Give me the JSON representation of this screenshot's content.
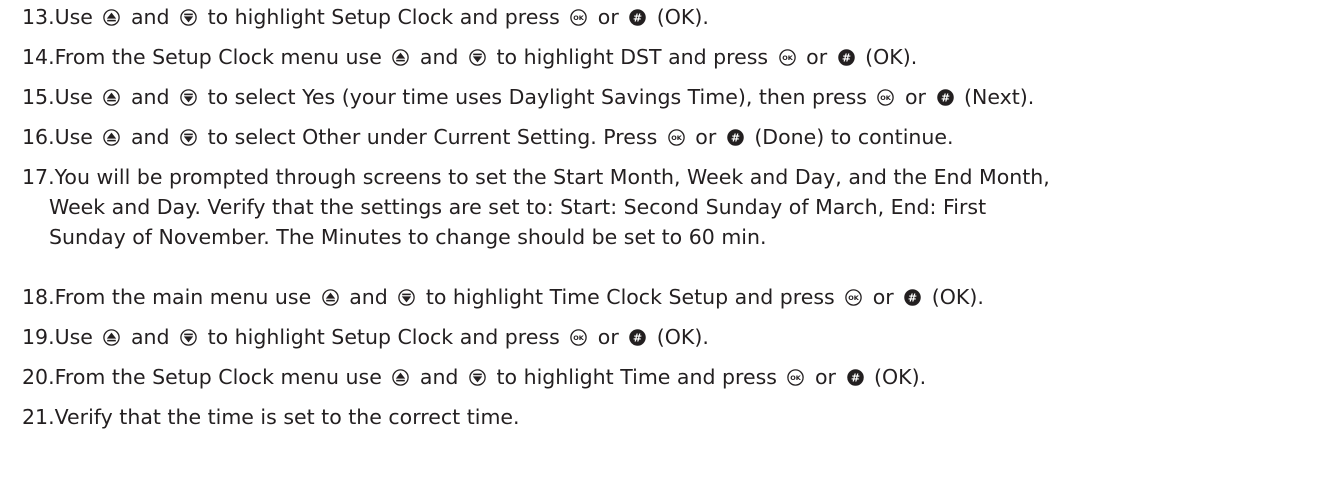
{
  "steps": [
    {
      "num": "13.",
      "parts": [
        {
          "t": "Use "
        },
        {
          "icon": "up-arrow-icon"
        },
        {
          "t": " and "
        },
        {
          "icon": "down-arrow-icon"
        },
        {
          "t": " to highlight Setup Clock and press "
        },
        {
          "icon": "ok-button-icon"
        },
        {
          "t": " or "
        },
        {
          "icon": "hash-button-icon"
        },
        {
          "t": " (OK)."
        }
      ]
    },
    {
      "num": "14.",
      "parts": [
        {
          "t": "From the Setup Clock menu use "
        },
        {
          "icon": "up-arrow-icon"
        },
        {
          "t": " and "
        },
        {
          "icon": "down-arrow-icon"
        },
        {
          "t": " to highlight DST and press "
        },
        {
          "icon": "ok-button-icon"
        },
        {
          "t": " or "
        },
        {
          "icon": "hash-button-icon"
        },
        {
          "t": " (OK)."
        }
      ]
    },
    {
      "num": "15.",
      "parts": [
        {
          "t": "Use "
        },
        {
          "icon": "up-arrow-icon"
        },
        {
          "t": " and "
        },
        {
          "icon": "down-arrow-icon"
        },
        {
          "t": " to select Yes (your time uses Daylight Savings Time), then press "
        },
        {
          "icon": "ok-button-icon"
        },
        {
          "t": " or "
        },
        {
          "icon": "hash-button-icon"
        },
        {
          "t": " (Next)."
        }
      ]
    },
    {
      "num": "16.",
      "parts": [
        {
          "t": "Use "
        },
        {
          "icon": "up-arrow-icon"
        },
        {
          "t": " and "
        },
        {
          "icon": "down-arrow-icon"
        },
        {
          "t": " to select Other under Current Setting. Press "
        },
        {
          "icon": "ok-button-icon"
        },
        {
          "t": " or "
        },
        {
          "icon": "hash-button-icon"
        },
        {
          "t": " (Done) to continue."
        }
      ]
    },
    {
      "num": "17.",
      "lines": [
        "You will be prompted through screens to set the Start Month, Week and Day, and the End Month,",
        "Week and Day. Verify that the settings are set to: Start: Second Sunday of March, End: First",
        "Sunday of November. The Minutes to change should be set to 60 min."
      ]
    },
    {
      "num": "18.",
      "parts": [
        {
          "t": "From the main menu use "
        },
        {
          "icon": "up-arrow-icon"
        },
        {
          "t": " and "
        },
        {
          "icon": "down-arrow-icon"
        },
        {
          "t": " to highlight Time Clock Setup and press "
        },
        {
          "icon": "ok-button-icon"
        },
        {
          "t": " or "
        },
        {
          "icon": "hash-button-icon"
        },
        {
          "t": " (OK)."
        }
      ]
    },
    {
      "num": "19.",
      "parts": [
        {
          "t": "Use "
        },
        {
          "icon": "up-arrow-icon"
        },
        {
          "t": " and "
        },
        {
          "icon": "down-arrow-icon"
        },
        {
          "t": " to highlight Setup Clock and press "
        },
        {
          "icon": "ok-button-icon"
        },
        {
          "t": " or "
        },
        {
          "icon": "hash-button-icon"
        },
        {
          "t": " (OK)."
        }
      ]
    },
    {
      "num": "20.",
      "parts": [
        {
          "t": "From the Setup Clock menu use "
        },
        {
          "icon": "up-arrow-icon"
        },
        {
          "t": " and "
        },
        {
          "icon": "down-arrow-icon"
        },
        {
          "t": " to highlight Time and press "
        },
        {
          "icon": "ok-button-icon"
        },
        {
          "t": " or "
        },
        {
          "icon": "hash-button-icon"
        },
        {
          "t": " (OK)."
        }
      ]
    },
    {
      "num": "21.",
      "parts": [
        {
          "t": "Verify that the time is set to the correct time."
        }
      ]
    }
  ],
  "icon_labels": {
    "ok-button-icon": "OK",
    "hash-button-icon": "#"
  },
  "colors": {
    "text": "#231f20"
  }
}
